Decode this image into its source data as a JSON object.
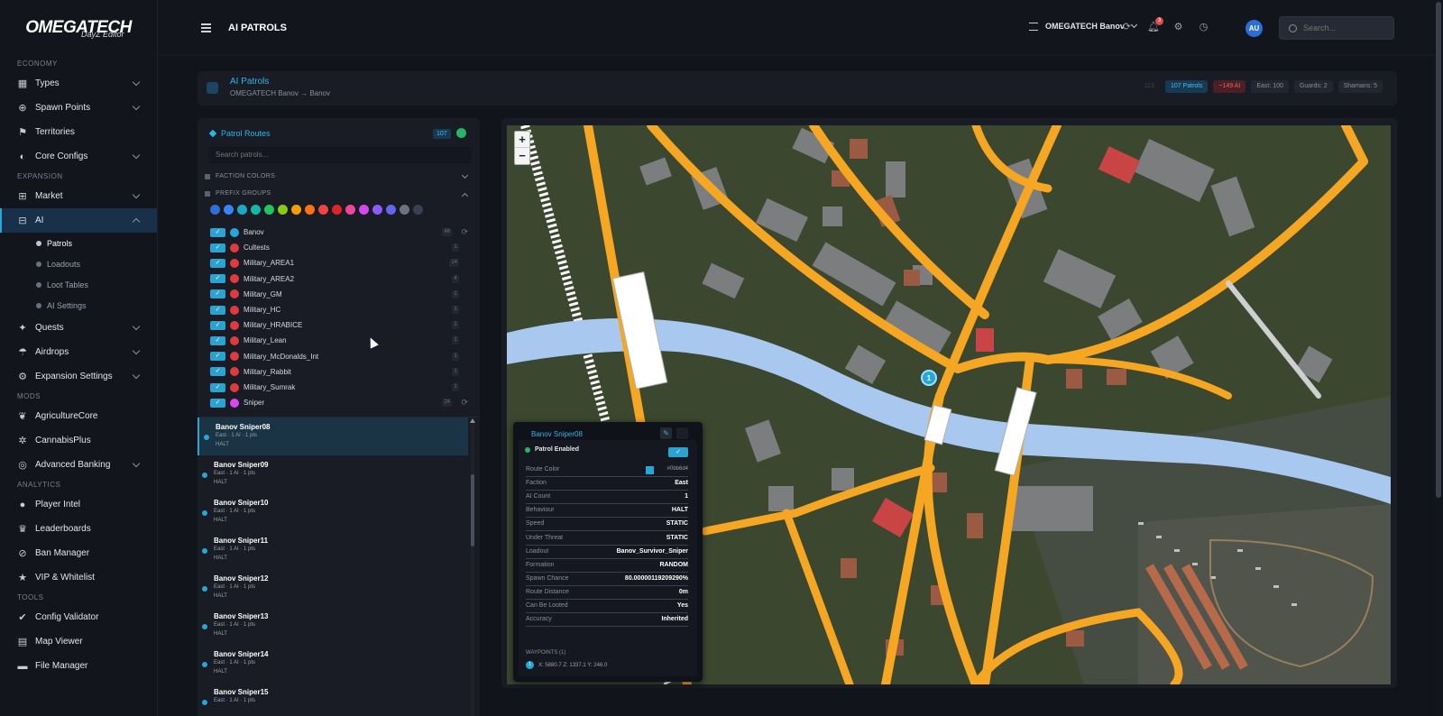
{
  "brand": {
    "logo": "OMEGATECH",
    "logo_sub": "DayZ Editor"
  },
  "sidebar": {
    "sections": [
      {
        "label": "ECONOMY",
        "items": [
          {
            "label": "Types",
            "icon": "types-icon",
            "chev": true
          },
          {
            "label": "Spawn Points",
            "icon": "crosshair-icon",
            "chev": true
          },
          {
            "label": "Territories",
            "icon": "flag-icon",
            "chev": false
          },
          {
            "label": "Core Configs",
            "icon": "config-icon",
            "chev": true
          }
        ]
      },
      {
        "label": "EXPANSION",
        "items": [
          {
            "label": "Market",
            "icon": "cart-icon",
            "chev": true
          },
          {
            "label": "AI",
            "icon": "robot-icon",
            "chev": true,
            "active": true
          }
        ]
      }
    ],
    "ai_sub": [
      {
        "label": "Patrols",
        "active": true
      },
      {
        "label": "Loadouts"
      },
      {
        "label": "Loot Tables"
      },
      {
        "label": "AI Settings"
      }
    ],
    "expansion_more": [
      {
        "label": "Quests",
        "icon": "quest-icon",
        "chev": true
      },
      {
        "label": "Airdrops",
        "icon": "parachute-icon",
        "chev": true
      },
      {
        "label": "Expansion Settings",
        "icon": "settings-icon",
        "chev": true
      }
    ],
    "mods_label": "MODS",
    "mods": [
      {
        "label": "AgricultureCore",
        "icon": "leaf-icon",
        "chev": false
      },
      {
        "label": "CannabisPlus",
        "icon": "cannabis-icon",
        "chev": false
      },
      {
        "label": "Advanced Banking",
        "icon": "bank-icon",
        "chev": true
      }
    ],
    "analytics_label": "ANALYTICS",
    "analytics": [
      {
        "label": "Player Intel",
        "icon": "user-icon"
      },
      {
        "label": "Leaderboards",
        "icon": "trophy-icon"
      },
      {
        "label": "Ban Manager",
        "icon": "ban-icon"
      },
      {
        "label": "VIP & Whitelist",
        "icon": "vip-icon"
      }
    ],
    "tools_label": "TOOLS",
    "tools": [
      {
        "label": "Config Validator",
        "icon": "validator-icon"
      },
      {
        "label": "Map Viewer",
        "icon": "map-icon"
      },
      {
        "label": "File Manager",
        "icon": "folder-icon"
      }
    ]
  },
  "topbar": {
    "title": "AI PATROLS",
    "server": "OMEGATECH Banov",
    "notifications": "3",
    "avatar": "AU",
    "search_placeholder": "Search..."
  },
  "header": {
    "title": "AI Patrols",
    "subtitle": "OMEGATECH Banov → Banov",
    "badges": [
      {
        "label": "113",
        "style": "dim"
      },
      {
        "label": "107 Patrols",
        "style": "blue"
      },
      {
        "label": "~149 AI",
        "style": "red"
      },
      {
        "label": "East: 100",
        "style": "plain"
      },
      {
        "label": "Guards: 2",
        "style": "plain"
      },
      {
        "label": "Shamans: 5",
        "style": "plain"
      }
    ]
  },
  "routes": {
    "title": "Patrol Routes",
    "count": "107",
    "search_placeholder": "Search patrols...",
    "faction_colors_label": "FACTION COLORS",
    "prefix_groups_label": "PREFIX GROUPS",
    "swatches": [
      "#2f6fd8",
      "#3b82f6",
      "#1ea7c7",
      "#14b8a6",
      "#22c55e",
      "#84cc16",
      "#f59e0b",
      "#f97316",
      "#ef4444",
      "#dc2626",
      "#ec4899",
      "#d946ef",
      "#8b5cf6",
      "#6366f1",
      "#6b7280",
      "#374151"
    ],
    "groups": [
      {
        "name": "Banov",
        "color": "#25a8d8",
        "count": "46",
        "reload": true
      },
      {
        "name": "Cultests",
        "color": "#e03a3a",
        "count": "1"
      },
      {
        "name": "Military_AREA1",
        "color": "#e03a3a",
        "count": "14"
      },
      {
        "name": "Military_AREA2",
        "color": "#e03a3a",
        "count": "4"
      },
      {
        "name": "Military_GM",
        "color": "#e03a3a",
        "count": "1"
      },
      {
        "name": "Military_HC",
        "color": "#e03a3a",
        "count": "1"
      },
      {
        "name": "Military_HRABICE",
        "color": "#e03a3a",
        "count": "1"
      },
      {
        "name": "Military_Lean",
        "color": "#e03a3a",
        "count": "1"
      },
      {
        "name": "Military_McDonalds_Int",
        "color": "#e03a3a",
        "count": "1"
      },
      {
        "name": "Military_Rabbit",
        "color": "#e03a3a",
        "count": "1"
      },
      {
        "name": "Military_Sumrak",
        "color": "#e03a3a",
        "count": "1"
      },
      {
        "name": "Sniper",
        "color": "#d946ef",
        "count": "24",
        "reload": true
      }
    ],
    "patrols": [
      {
        "name": "Banov Sniper08",
        "meta": "East · 1 AI · 1 pts",
        "mode": "HALT",
        "active": true
      },
      {
        "name": "Banov Sniper09",
        "meta": "East · 1 AI · 1 pts",
        "mode": "HALT"
      },
      {
        "name": "Banov Sniper10",
        "meta": "East · 1 AI · 1 pts",
        "mode": "HALT"
      },
      {
        "name": "Banov Sniper11",
        "meta": "East · 1 AI · 1 pts",
        "mode": "HALT"
      },
      {
        "name": "Banov Sniper12",
        "meta": "East · 1 AI · 1 pts",
        "mode": "HALT"
      },
      {
        "name": "Banov Sniper13",
        "meta": "East · 1 AI · 1 pts",
        "mode": "HALT"
      },
      {
        "name": "Banov Sniper14",
        "meta": "East · 1 AI · 1 pts",
        "mode": "HALT"
      },
      {
        "name": "Banov Sniper15",
        "meta": "East · 1 AI · 1 pts",
        "mode": ""
      }
    ]
  },
  "map": {
    "zoom_in": "+",
    "zoom_out": "−",
    "marker": "1"
  },
  "popup": {
    "title": "Banov Sniper08",
    "enabled_label": "Patrol Enabled",
    "rows": [
      {
        "k": "Route Color",
        "v": "#0bb6d4",
        "swatch": true
      },
      {
        "k": "Faction",
        "v": "East"
      },
      {
        "k": "AI Count",
        "v": "1"
      },
      {
        "k": "Behaviour",
        "v": "HALT"
      },
      {
        "k": "Speed",
        "v": "STATIC"
      },
      {
        "k": "Under Threat",
        "v": "STATIC"
      },
      {
        "k": "Loadout",
        "v": "Banov_Survivor_Sniper"
      },
      {
        "k": "Formation",
        "v": "RANDOM"
      },
      {
        "k": "Spawn Chance",
        "v": "80.00000119209290%"
      },
      {
        "k": "Route Distance",
        "v": "0m"
      },
      {
        "k": "Can Be Looted",
        "v": "Yes"
      },
      {
        "k": "Accuracy",
        "v": "Inherited"
      }
    ],
    "waypoints_label": "WAYPOINTS (1)",
    "waypoint": {
      "n": "1",
      "text": "X: 5880.7  Z: 1337.1  Y: 246.0"
    }
  }
}
